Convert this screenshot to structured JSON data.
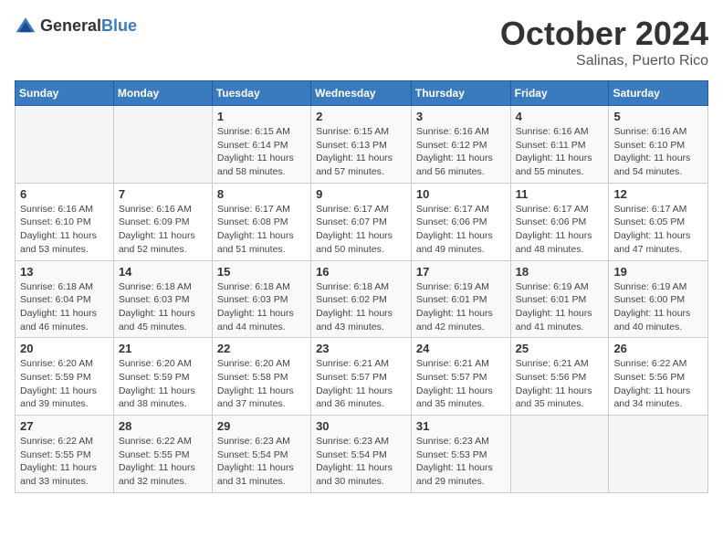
{
  "logo": {
    "general": "General",
    "blue": "Blue"
  },
  "title": "October 2024",
  "location": "Salinas, Puerto Rico",
  "headers": [
    "Sunday",
    "Monday",
    "Tuesday",
    "Wednesday",
    "Thursday",
    "Friday",
    "Saturday"
  ],
  "weeks": [
    [
      {
        "day": "",
        "detail": ""
      },
      {
        "day": "",
        "detail": ""
      },
      {
        "day": "1",
        "detail": "Sunrise: 6:15 AM\nSunset: 6:14 PM\nDaylight: 11 hours and 58 minutes."
      },
      {
        "day": "2",
        "detail": "Sunrise: 6:15 AM\nSunset: 6:13 PM\nDaylight: 11 hours and 57 minutes."
      },
      {
        "day": "3",
        "detail": "Sunrise: 6:16 AM\nSunset: 6:12 PM\nDaylight: 11 hours and 56 minutes."
      },
      {
        "day": "4",
        "detail": "Sunrise: 6:16 AM\nSunset: 6:11 PM\nDaylight: 11 hours and 55 minutes."
      },
      {
        "day": "5",
        "detail": "Sunrise: 6:16 AM\nSunset: 6:10 PM\nDaylight: 11 hours and 54 minutes."
      }
    ],
    [
      {
        "day": "6",
        "detail": "Sunrise: 6:16 AM\nSunset: 6:10 PM\nDaylight: 11 hours and 53 minutes."
      },
      {
        "day": "7",
        "detail": "Sunrise: 6:16 AM\nSunset: 6:09 PM\nDaylight: 11 hours and 52 minutes."
      },
      {
        "day": "8",
        "detail": "Sunrise: 6:17 AM\nSunset: 6:08 PM\nDaylight: 11 hours and 51 minutes."
      },
      {
        "day": "9",
        "detail": "Sunrise: 6:17 AM\nSunset: 6:07 PM\nDaylight: 11 hours and 50 minutes."
      },
      {
        "day": "10",
        "detail": "Sunrise: 6:17 AM\nSunset: 6:06 PM\nDaylight: 11 hours and 49 minutes."
      },
      {
        "day": "11",
        "detail": "Sunrise: 6:17 AM\nSunset: 6:06 PM\nDaylight: 11 hours and 48 minutes."
      },
      {
        "day": "12",
        "detail": "Sunrise: 6:17 AM\nSunset: 6:05 PM\nDaylight: 11 hours and 47 minutes."
      }
    ],
    [
      {
        "day": "13",
        "detail": "Sunrise: 6:18 AM\nSunset: 6:04 PM\nDaylight: 11 hours and 46 minutes."
      },
      {
        "day": "14",
        "detail": "Sunrise: 6:18 AM\nSunset: 6:03 PM\nDaylight: 11 hours and 45 minutes."
      },
      {
        "day": "15",
        "detail": "Sunrise: 6:18 AM\nSunset: 6:03 PM\nDaylight: 11 hours and 44 minutes."
      },
      {
        "day": "16",
        "detail": "Sunrise: 6:18 AM\nSunset: 6:02 PM\nDaylight: 11 hours and 43 minutes."
      },
      {
        "day": "17",
        "detail": "Sunrise: 6:19 AM\nSunset: 6:01 PM\nDaylight: 11 hours and 42 minutes."
      },
      {
        "day": "18",
        "detail": "Sunrise: 6:19 AM\nSunset: 6:01 PM\nDaylight: 11 hours and 41 minutes."
      },
      {
        "day": "19",
        "detail": "Sunrise: 6:19 AM\nSunset: 6:00 PM\nDaylight: 11 hours and 40 minutes."
      }
    ],
    [
      {
        "day": "20",
        "detail": "Sunrise: 6:20 AM\nSunset: 5:59 PM\nDaylight: 11 hours and 39 minutes."
      },
      {
        "day": "21",
        "detail": "Sunrise: 6:20 AM\nSunset: 5:59 PM\nDaylight: 11 hours and 38 minutes."
      },
      {
        "day": "22",
        "detail": "Sunrise: 6:20 AM\nSunset: 5:58 PM\nDaylight: 11 hours and 37 minutes."
      },
      {
        "day": "23",
        "detail": "Sunrise: 6:21 AM\nSunset: 5:57 PM\nDaylight: 11 hours and 36 minutes."
      },
      {
        "day": "24",
        "detail": "Sunrise: 6:21 AM\nSunset: 5:57 PM\nDaylight: 11 hours and 35 minutes."
      },
      {
        "day": "25",
        "detail": "Sunrise: 6:21 AM\nSunset: 5:56 PM\nDaylight: 11 hours and 35 minutes."
      },
      {
        "day": "26",
        "detail": "Sunrise: 6:22 AM\nSunset: 5:56 PM\nDaylight: 11 hours and 34 minutes."
      }
    ],
    [
      {
        "day": "27",
        "detail": "Sunrise: 6:22 AM\nSunset: 5:55 PM\nDaylight: 11 hours and 33 minutes."
      },
      {
        "day": "28",
        "detail": "Sunrise: 6:22 AM\nSunset: 5:55 PM\nDaylight: 11 hours and 32 minutes."
      },
      {
        "day": "29",
        "detail": "Sunrise: 6:23 AM\nSunset: 5:54 PM\nDaylight: 11 hours and 31 minutes."
      },
      {
        "day": "30",
        "detail": "Sunrise: 6:23 AM\nSunset: 5:54 PM\nDaylight: 11 hours and 30 minutes."
      },
      {
        "day": "31",
        "detail": "Sunrise: 6:23 AM\nSunset: 5:53 PM\nDaylight: 11 hours and 29 minutes."
      },
      {
        "day": "",
        "detail": ""
      },
      {
        "day": "",
        "detail": ""
      }
    ]
  ]
}
